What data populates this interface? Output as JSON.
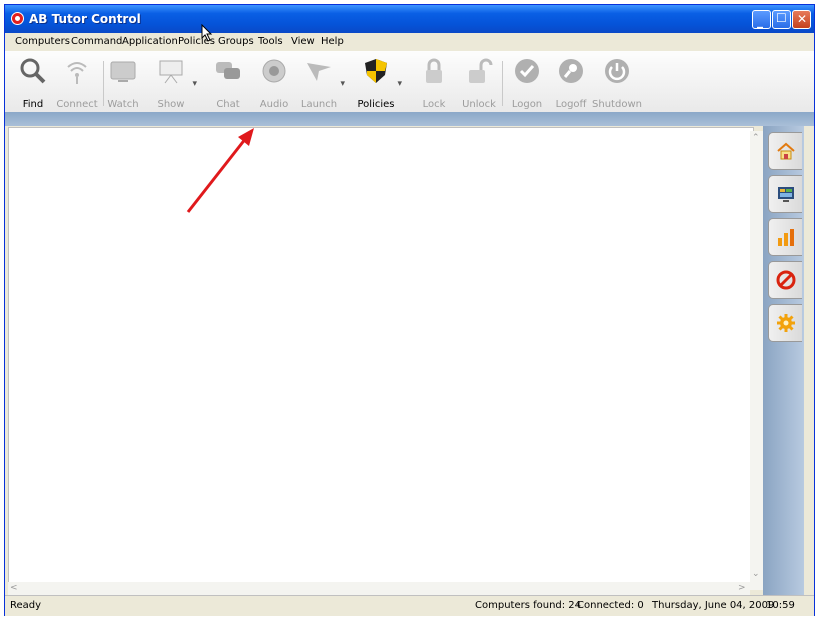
{
  "window": {
    "title": "AB Tutor Control"
  },
  "menu": [
    {
      "label": "Computers",
      "key": "computers"
    },
    {
      "label": "Command",
      "key": "command"
    },
    {
      "label": "Application",
      "key": "application"
    },
    {
      "label": "Policies",
      "key": "policies"
    },
    {
      "label": "Groups",
      "key": "groups"
    },
    {
      "label": "Tools",
      "key": "tools"
    },
    {
      "label": "View",
      "key": "view"
    },
    {
      "label": "Help",
      "key": "help"
    }
  ],
  "toolbar": {
    "find": "Find",
    "connect": "Connect",
    "watch": "Watch",
    "show": "Show",
    "chat": "Chat",
    "audio": "Audio",
    "launch": "Launch",
    "policies": "Policies",
    "lock": "Lock",
    "unlock": "Unlock",
    "logon": "Logon",
    "logoff": "Logoff",
    "shutdown": "Shutdown"
  },
  "status": {
    "ready": "Ready",
    "computers_found": "Computers found: 24",
    "connected": "Connected: 0",
    "date": "Thursday, June 04, 2009",
    "time": "10:59"
  },
  "icons": {
    "home": "home-icon",
    "screens": "screens-icon",
    "chart": "chart-icon",
    "block": "block-icon",
    "settings": "gear-icon"
  },
  "colors": {
    "title_bar": "#0553d8",
    "annotation_arrow": "#e0191c",
    "side_panel": "#9db4d0"
  }
}
